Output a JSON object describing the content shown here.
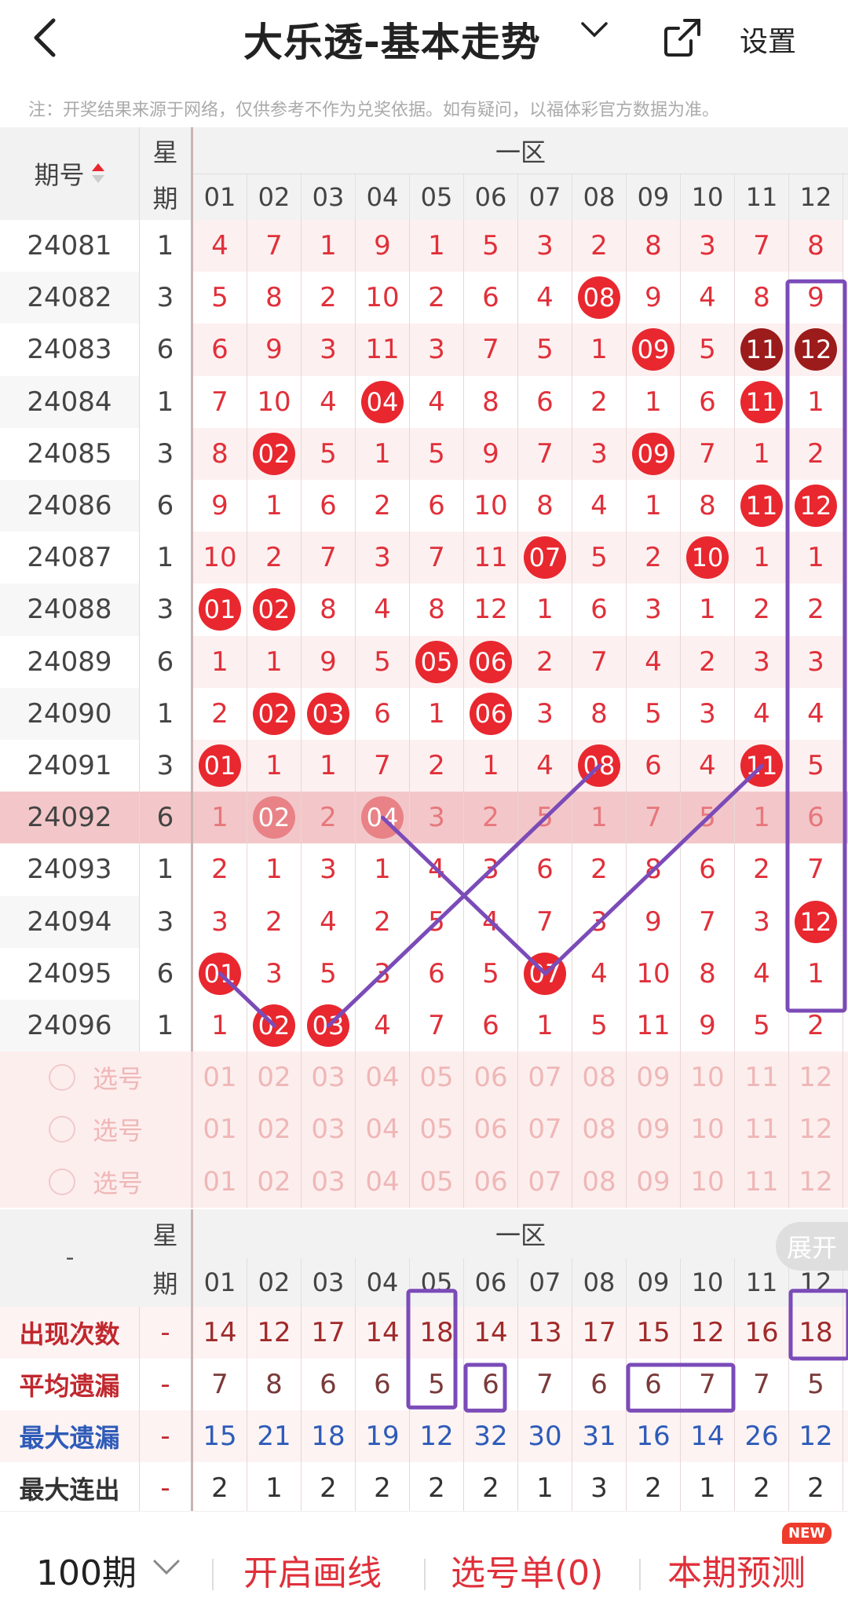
{
  "header": {
    "title": "大乐透-基本走势",
    "settings": "设置",
    "notice": "注：开奖结果来源于网络，仅供参考不作为兑奖依据。如有疑问，以福体彩官方数据为准。"
  },
  "table": {
    "issue_header": "期号",
    "week_header_1": "星",
    "week_header_2": "期",
    "zone_header": "一区",
    "columns": [
      "01",
      "02",
      "03",
      "04",
      "05",
      "06",
      "07",
      "08",
      "09",
      "10",
      "11",
      "12"
    ],
    "rows": [
      {
        "issue": "24081",
        "week": "1",
        "cells": [
          "4",
          "7",
          "1",
          "9",
          "1",
          "5",
          "3",
          "2",
          "8",
          "3",
          "7",
          "8"
        ],
        "hits": []
      },
      {
        "issue": "24082",
        "week": "3",
        "cells": [
          "5",
          "8",
          "2",
          "10",
          "2",
          "6",
          "4",
          "08",
          "9",
          "4",
          "8",
          "9"
        ],
        "hits": [
          7
        ]
      },
      {
        "issue": "24083",
        "week": "6",
        "cells": [
          "6",
          "9",
          "3",
          "11",
          "3",
          "7",
          "5",
          "1",
          "09",
          "5",
          "11",
          "12"
        ],
        "hits": [
          8,
          10,
          11
        ],
        "dark": [
          10,
          11
        ]
      },
      {
        "issue": "24084",
        "week": "1",
        "cells": [
          "7",
          "10",
          "4",
          "04",
          "4",
          "8",
          "6",
          "2",
          "1",
          "6",
          "11",
          "1"
        ],
        "hits": [
          3,
          10
        ]
      },
      {
        "issue": "24085",
        "week": "3",
        "cells": [
          "8",
          "02",
          "5",
          "1",
          "5",
          "9",
          "7",
          "3",
          "09",
          "7",
          "1",
          "2"
        ],
        "hits": [
          1,
          8
        ]
      },
      {
        "issue": "24086",
        "week": "6",
        "cells": [
          "9",
          "1",
          "6",
          "2",
          "6",
          "10",
          "8",
          "4",
          "1",
          "8",
          "11",
          "12"
        ],
        "hits": [
          10,
          11
        ]
      },
      {
        "issue": "24087",
        "week": "1",
        "cells": [
          "10",
          "2",
          "7",
          "3",
          "7",
          "11",
          "07",
          "5",
          "2",
          "10",
          "1",
          "1"
        ],
        "hits": [
          6,
          9
        ]
      },
      {
        "issue": "24088",
        "week": "3",
        "cells": [
          "01",
          "02",
          "8",
          "4",
          "8",
          "12",
          "1",
          "6",
          "3",
          "1",
          "2",
          "2"
        ],
        "hits": [
          0,
          1
        ]
      },
      {
        "issue": "24089",
        "week": "6",
        "cells": [
          "1",
          "1",
          "9",
          "5",
          "05",
          "06",
          "2",
          "7",
          "4",
          "2",
          "3",
          "3"
        ],
        "hits": [
          4,
          5
        ]
      },
      {
        "issue": "24090",
        "week": "1",
        "cells": [
          "2",
          "02",
          "03",
          "6",
          "1",
          "06",
          "3",
          "8",
          "5",
          "3",
          "4",
          "4"
        ],
        "hits": [
          1,
          2,
          5
        ]
      },
      {
        "issue": "24091",
        "week": "3",
        "cells": [
          "01",
          "1",
          "1",
          "7",
          "2",
          "1",
          "4",
          "08",
          "6",
          "4",
          "11",
          "5"
        ],
        "hits": [
          0,
          7,
          10
        ]
      },
      {
        "issue": "24092",
        "week": "6",
        "cells": [
          "1",
          "02",
          "2",
          "04",
          "3",
          "2",
          "5",
          "1",
          "7",
          "5",
          "1",
          "6"
        ],
        "hits": [
          1,
          3
        ],
        "highlight": true
      },
      {
        "issue": "24093",
        "week": "1",
        "cells": [
          "2",
          "1",
          "3",
          "1",
          "4",
          "3",
          "6",
          "2",
          "8",
          "6",
          "2",
          "7"
        ],
        "hits": []
      },
      {
        "issue": "24094",
        "week": "3",
        "cells": [
          "3",
          "2",
          "4",
          "2",
          "5",
          "4",
          "7",
          "3",
          "9",
          "7",
          "3",
          "12"
        ],
        "hits": [
          11
        ]
      },
      {
        "issue": "24095",
        "week": "6",
        "cells": [
          "01",
          "3",
          "5",
          "3",
          "6",
          "5",
          "07",
          "4",
          "10",
          "8",
          "4",
          "1"
        ],
        "hits": [
          0,
          6
        ]
      },
      {
        "issue": "24096",
        "week": "1",
        "cells": [
          "1",
          "02",
          "03",
          "4",
          "7",
          "6",
          "1",
          "5",
          "11",
          "9",
          "5",
          "2"
        ],
        "hits": [
          1,
          2
        ]
      }
    ],
    "select_label": "选号"
  },
  "stats": {
    "corner": "-",
    "rows": [
      {
        "label": "出现次数",
        "color": "#c0272d",
        "week": "-",
        "values": [
          "14",
          "12",
          "17",
          "14",
          "18",
          "14",
          "13",
          "17",
          "15",
          "12",
          "16",
          "18"
        ],
        "vcolor": "#a02a2a"
      },
      {
        "label": "平均遗漏",
        "color": "#c0272d",
        "week": "-",
        "values": [
          "7",
          "8",
          "6",
          "6",
          "5",
          "6",
          "7",
          "6",
          "6",
          "7",
          "7",
          "5"
        ],
        "vcolor": "#7a3a3a"
      },
      {
        "label": "最大遗漏",
        "color": "#2e5bb8",
        "week": "-",
        "values": [
          "15",
          "21",
          "18",
          "19",
          "12",
          "32",
          "30",
          "31",
          "16",
          "14",
          "26",
          "12"
        ],
        "vcolor": "#2e5bb8"
      },
      {
        "label": "最大连出",
        "color": "#333333",
        "week": "-",
        "values": [
          "2",
          "1",
          "2",
          "2",
          "2",
          "2",
          "1",
          "3",
          "2",
          "1",
          "2",
          "2"
        ],
        "vcolor": "#333333"
      }
    ]
  },
  "expand": "展开",
  "footer": {
    "period": "100期",
    "draw_line": "开启画线",
    "pick_list": "选号单(0)",
    "predict": "本期预测",
    "new_badge": "NEW"
  },
  "colors": {
    "red": "#e8272f",
    "dark_red": "#9c1b1b",
    "purple": "#7b4bb8",
    "highlight": "#f3c7c9"
  }
}
